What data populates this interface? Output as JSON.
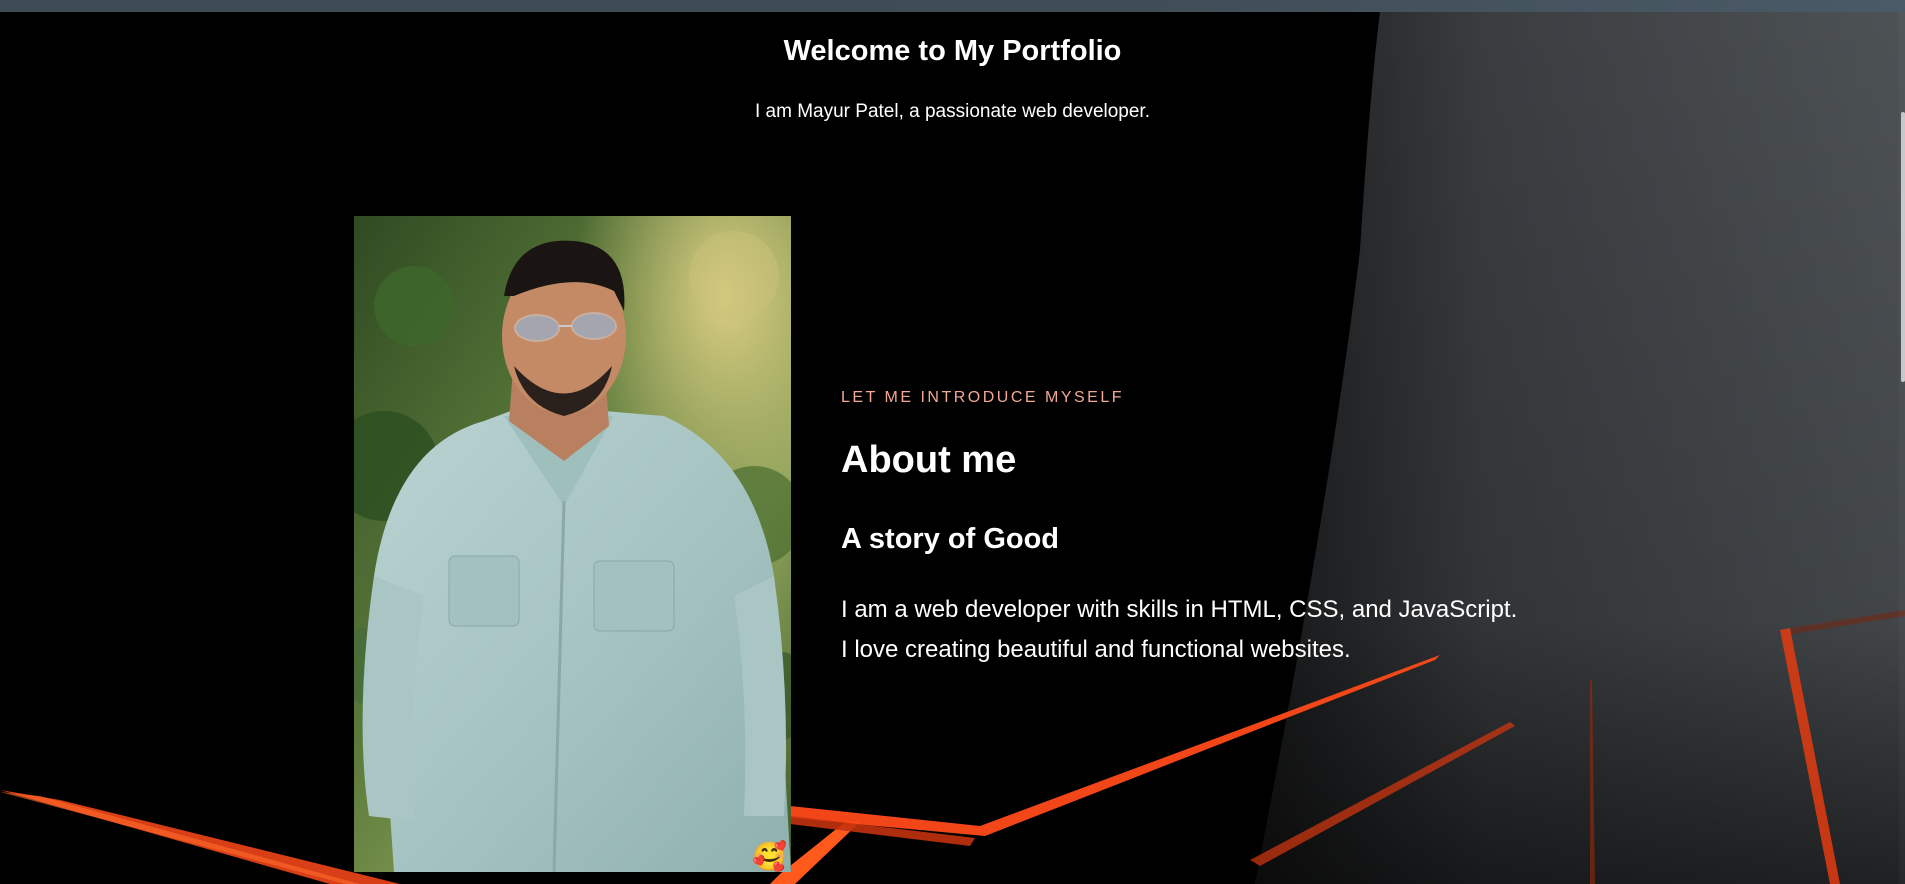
{
  "header": {
    "title": "Welcome to My Portfolio",
    "subtitle": "I am Mayur Patel, a passionate web developer."
  },
  "about": {
    "eyebrow": "LET ME INTRODUCE MYSELF",
    "heading": "About me",
    "subheading": "A story of Good",
    "bio_line1": "I am a web developer with skills in HTML, CSS, and JavaScript.",
    "bio_line2": "I love creating beautiful and functional websites."
  },
  "colors": {
    "accent": "#f3a893",
    "background": "#000000",
    "text": "#ffffff",
    "stripe": "#ff4a1a"
  },
  "icons": {
    "emoji": "🥰"
  }
}
